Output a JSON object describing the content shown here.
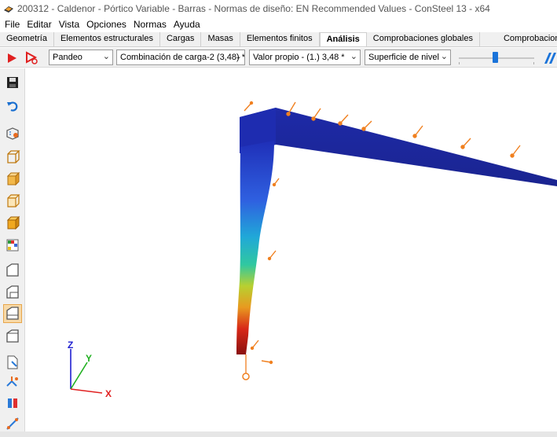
{
  "window": {
    "title": "200312 - Caldenor - Pórtico Variable - Barras - Normas de diseño: EN Recommended Values - ConSteel 13 - x64",
    "icon": "consteel-app-icon"
  },
  "menu": [
    "File",
    "Editar",
    "Vista",
    "Opciones",
    "Normas",
    "Ayuda"
  ],
  "tabs": [
    {
      "label": "Geometría",
      "active": false
    },
    {
      "label": "Elementos estructurales",
      "active": false
    },
    {
      "label": "Cargas",
      "active": false
    },
    {
      "label": "Masas",
      "active": false
    },
    {
      "label": "Elementos finitos",
      "active": false
    },
    {
      "label": "Análisis",
      "active": true
    },
    {
      "label": "Comprobaciones globales",
      "active": false
    },
    {
      "label": "Comprobaciones del elem",
      "active": false
    }
  ],
  "toolbar": {
    "run_icon": "play-icon",
    "run_settings_icon": "play-settings-icon",
    "analysis_type": "Pandeo",
    "load_combination": "Combinación de carga-2 (3,48) *",
    "eigenvalue": "Valor propio - (1.)  3,48 *",
    "display_mode": "Superficie de nivel",
    "slider_level": 0.45,
    "brand_icon": "consteel-logo-icon"
  },
  "left_tools": [
    "save-icon",
    "undo-icon",
    "model-settings-icon",
    "view-wireframe-icon",
    "view-solid-icon",
    "view-transparent-icon",
    "view-rendered-icon",
    "view-results-icon",
    "section-view-1-icon",
    "section-view-2-icon",
    "section-view-3-icon",
    "section-view-4-icon",
    "document-icon",
    "structure-members-icon",
    "section-properties-icon",
    "measure-icon"
  ],
  "viewport": {
    "axis_labels": {
      "x": "X",
      "y": "Y",
      "z": "Z"
    },
    "colors": {
      "axis_x": "#e02020",
      "axis_y": "#20b020",
      "axis_z": "#2020d0",
      "load_arrow": "#f08020"
    }
  }
}
